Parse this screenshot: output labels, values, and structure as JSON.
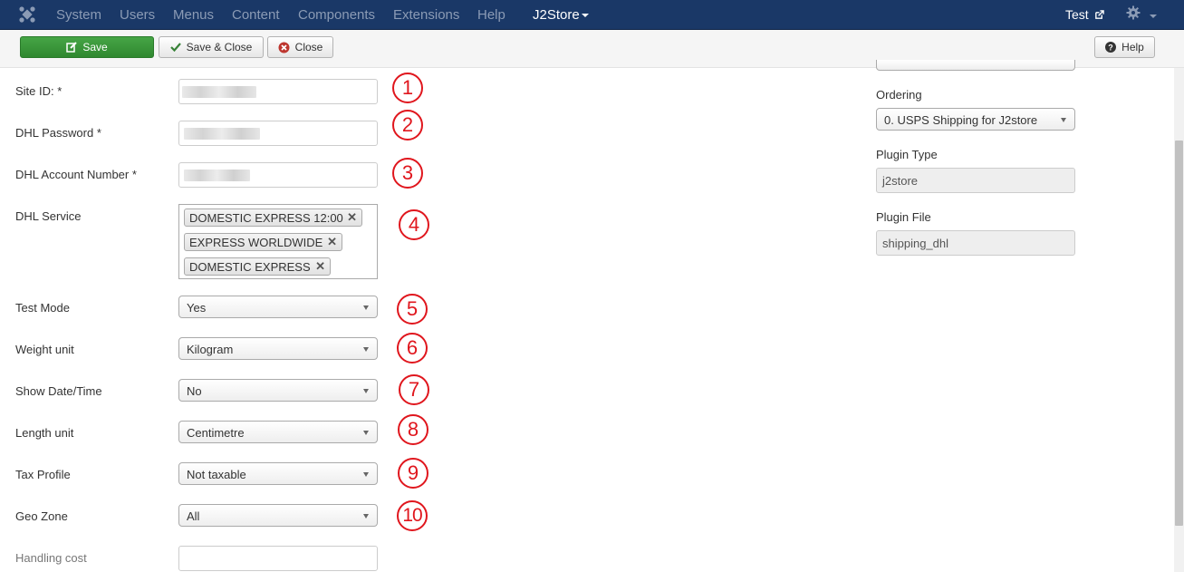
{
  "nav": {
    "items": [
      "System",
      "Users",
      "Menus",
      "Content",
      "Components",
      "Extensions",
      "Help"
    ],
    "active": "J2Store",
    "user": "Test"
  },
  "toolbar": {
    "save": "Save",
    "save_close": "Save & Close",
    "close": "Close",
    "help": "Help"
  },
  "form": {
    "site_id_label": "Site ID: *",
    "password_label": "DHL Password *",
    "account_label": "DHL Account Number *",
    "service_label": "DHL Service",
    "services": [
      "DOMESTIC EXPRESS 12:00",
      "EXPRESS WORLDWIDE",
      "DOMESTIC EXPRESS"
    ],
    "test_mode_label": "Test Mode",
    "test_mode_value": "Yes",
    "weight_label": "Weight unit",
    "weight_value": "Kilogram",
    "datetime_label": "Show Date/Time",
    "datetime_value": "No",
    "length_label": "Length unit",
    "length_value": "Centimetre",
    "tax_label": "Tax Profile",
    "tax_value": "Not taxable",
    "geo_label": "Geo Zone",
    "geo_value": "All",
    "handling_label": "Handling cost"
  },
  "callouts": [
    "1",
    "2",
    "3",
    "4",
    "5",
    "6",
    "7",
    "8",
    "9",
    "10"
  ],
  "sidebar": {
    "ordering_label": "Ordering",
    "ordering_value": "0. USPS Shipping for J2store",
    "plugin_type_label": "Plugin Type",
    "plugin_type_value": "j2store",
    "plugin_file_label": "Plugin File",
    "plugin_file_value": "shipping_dhl"
  },
  "colors": {
    "navbar": "#1a3867",
    "save": "#3d9b3d",
    "callout": "#e0161d"
  }
}
